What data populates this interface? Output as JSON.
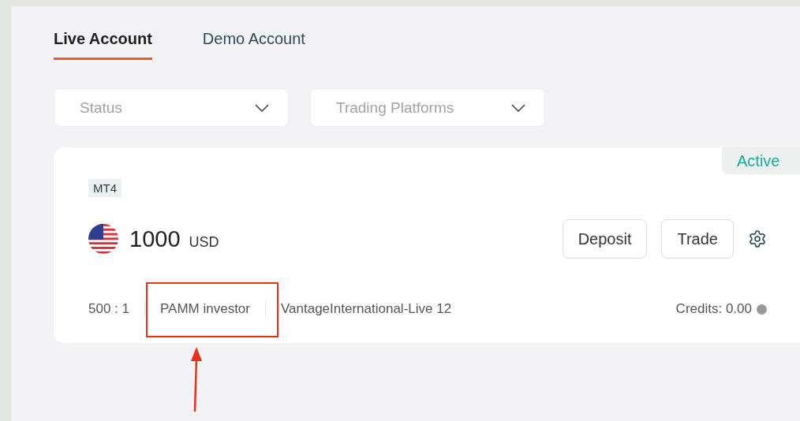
{
  "tabs": [
    {
      "label": "Live Account",
      "selected": true
    },
    {
      "label": "Demo Account",
      "selected": false
    }
  ],
  "filters": [
    {
      "placeholder": "Status"
    },
    {
      "placeholder": "Trading Platforms"
    }
  ],
  "account": {
    "platform": "MT4",
    "status": "Active",
    "balance": "1000",
    "currency": "USD",
    "buttons": [
      "Deposit",
      "Trade"
    ],
    "leverage": "500 : 1",
    "account_type": "PAMM investor",
    "server": "VantageInternational-Live 12",
    "credits": "Credits: 0.00"
  }
}
